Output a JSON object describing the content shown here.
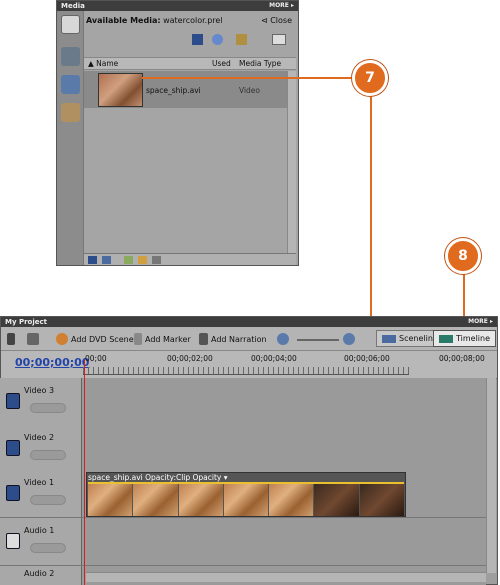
{
  "media_panel": {
    "title": "Media",
    "more": "MORE ▸",
    "available_media": "Available Media:",
    "project_file": "watercolor.prel",
    "close": "⊲ Close",
    "columns": [
      "▲ Name",
      "Used",
      "Media Type"
    ],
    "item": {
      "name": "space_ship.avi",
      "media_type": "Video"
    }
  },
  "project_panel": {
    "title": "My Project",
    "more": "MORE ▸",
    "toolbar": {
      "add_dvd_scene": "Add DVD Scene",
      "add_marker": "Add Marker",
      "add_narration": "Add Narration",
      "sceneline": "Sceneline",
      "timeline": "Timeline"
    },
    "timecode": "00;00;00;00",
    "ruler_ticks": [
      "00;00",
      "00;00;02;00",
      "00;00;04;00",
      "00;00;06;00",
      "00;00;08;00"
    ],
    "tracks": [
      "Video 3",
      "Video 2",
      "Video 1",
      "Audio 1",
      "Audio 2"
    ],
    "clip_label": "space_ship.avi  Opacity:Clip Opacity ▾"
  },
  "callouts": [
    "7",
    "8"
  ]
}
